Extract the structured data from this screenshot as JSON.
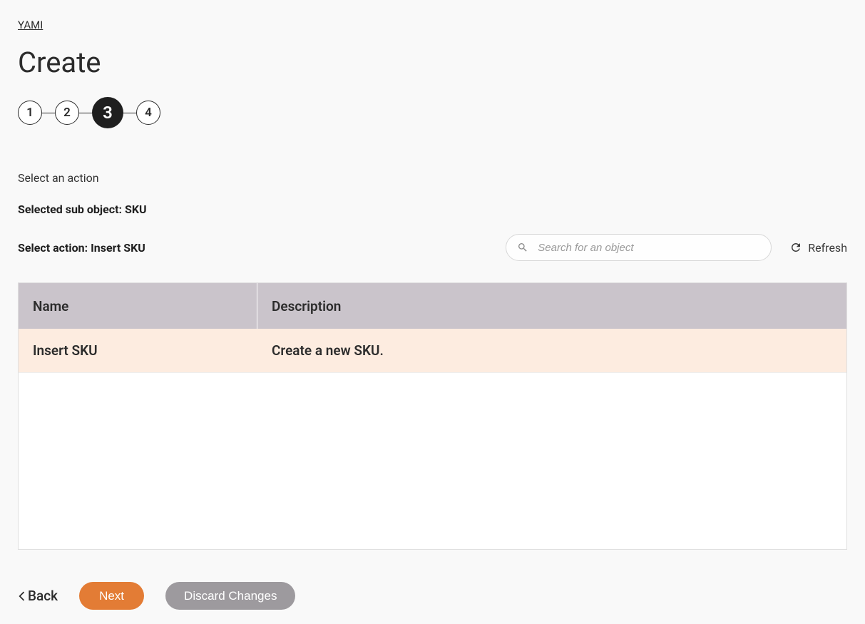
{
  "breadcrumb": {
    "home": "YAMI"
  },
  "page": {
    "title": "Create",
    "instruction": "Select an action",
    "selected_sub_object": "Selected sub object: SKU",
    "selected_action": "Select action: Insert SKU"
  },
  "stepper": {
    "steps": [
      "1",
      "2",
      "3",
      "4"
    ],
    "active_index": 2
  },
  "search": {
    "placeholder": "Search for an object",
    "value": ""
  },
  "refresh": {
    "label": "Refresh"
  },
  "table": {
    "columns": {
      "name": "Name",
      "description": "Description"
    },
    "rows": [
      {
        "name": "Insert SKU",
        "description": "Create a new SKU."
      }
    ]
  },
  "footer": {
    "back": "Back",
    "next": "Next",
    "discard": "Discard Changes"
  }
}
